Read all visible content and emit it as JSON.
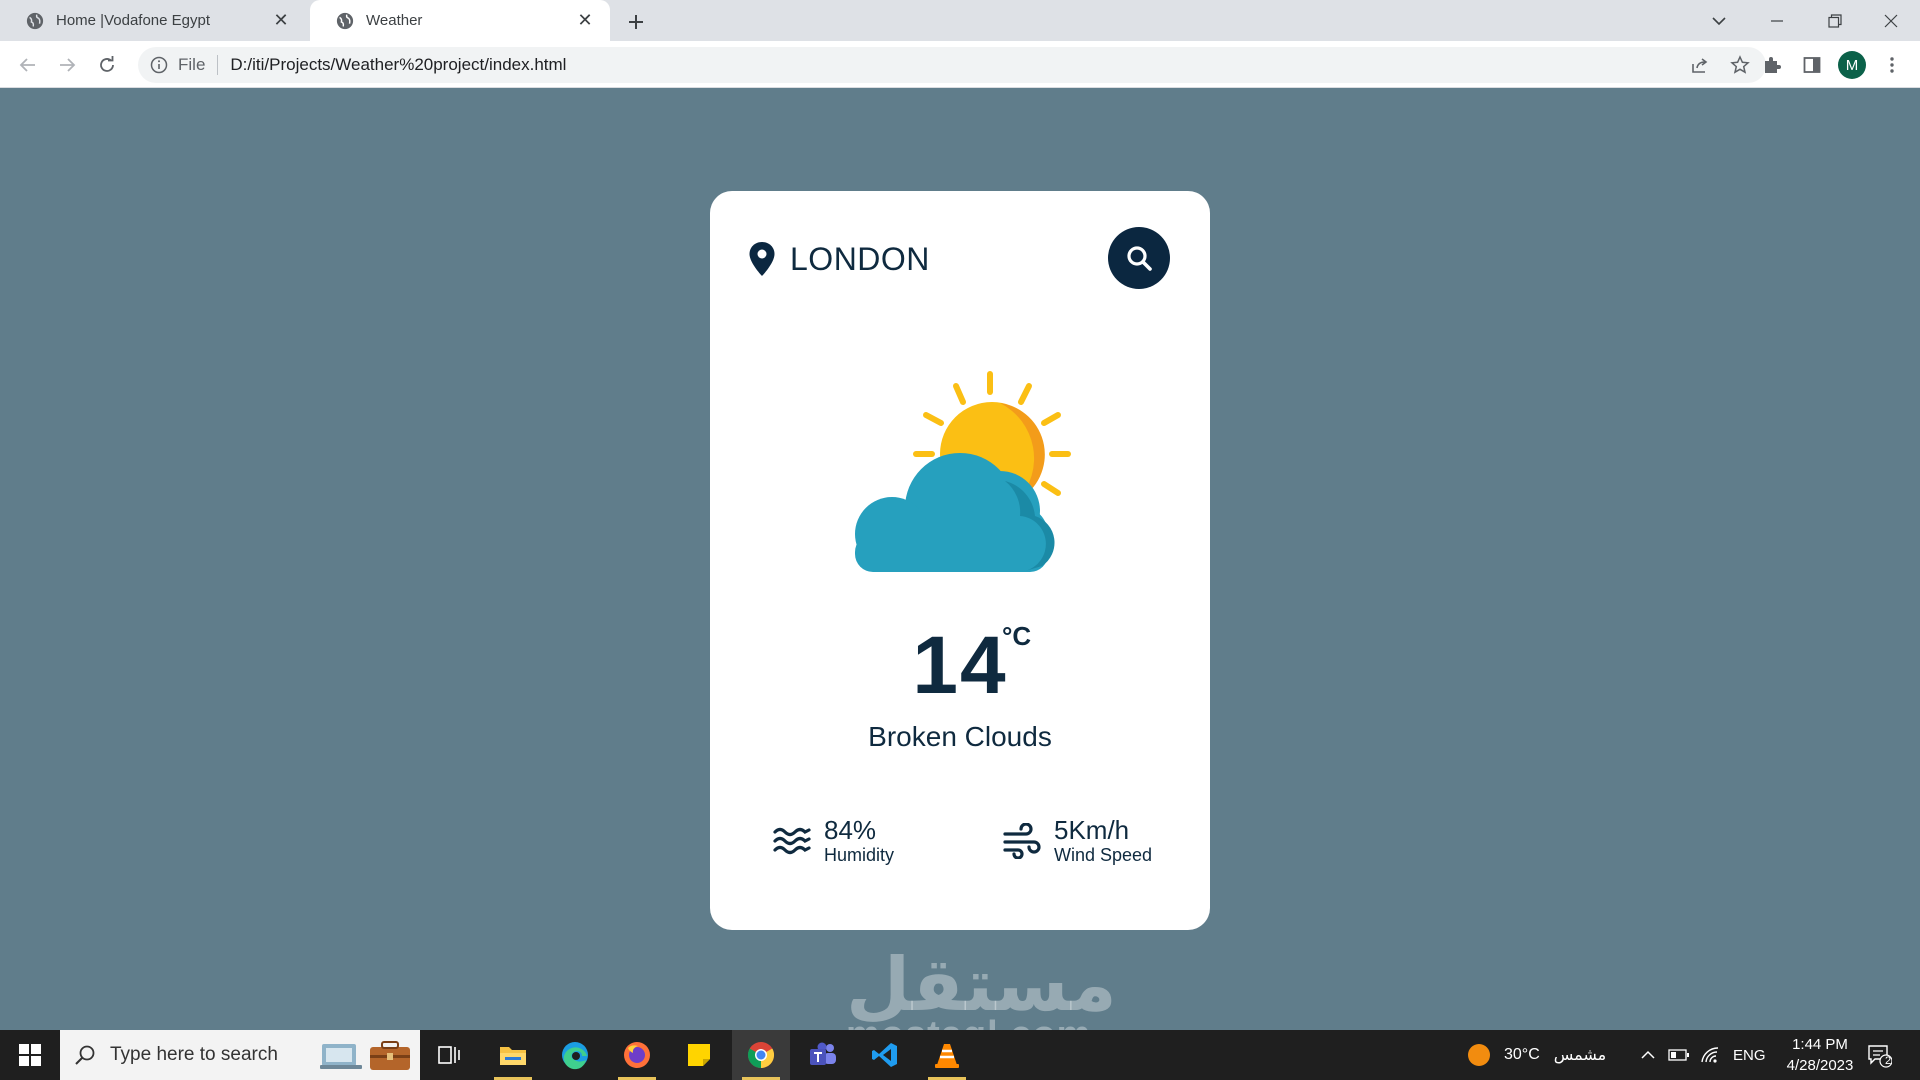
{
  "browser": {
    "tabs": [
      {
        "title": "Home |Vodafone Egypt",
        "active": false
      },
      {
        "title": "Weather",
        "active": true
      }
    ],
    "address": {
      "scheme_label": "File",
      "url": "D:/iti/Projects/Weather%20project/index.html"
    },
    "profile_initial": "M"
  },
  "weather": {
    "city": "LONDON",
    "temperature": "14",
    "unit": "°C",
    "description": "Broken Clouds",
    "humidity": {
      "value": "84%",
      "label": "Humidity"
    },
    "wind": {
      "value": "5Km/h",
      "label": "Wind Speed"
    }
  },
  "watermark": {
    "arabic": "مستقل",
    "latin": "mostaql.com"
  },
  "taskbar": {
    "search_placeholder": "Type here to search",
    "weather_temp": "30°C",
    "weather_text": "مشمس",
    "language": "ENG",
    "time": "1:44 PM",
    "date": "4/28/2023",
    "notification_count": "2"
  },
  "colors": {
    "page_background": "#607d8b",
    "card_background": "#ffffff",
    "primary_dark": "#0f2a3f",
    "search_button": "#0b2740",
    "sun": "#fbbf14",
    "cloud": "#26a0be"
  }
}
